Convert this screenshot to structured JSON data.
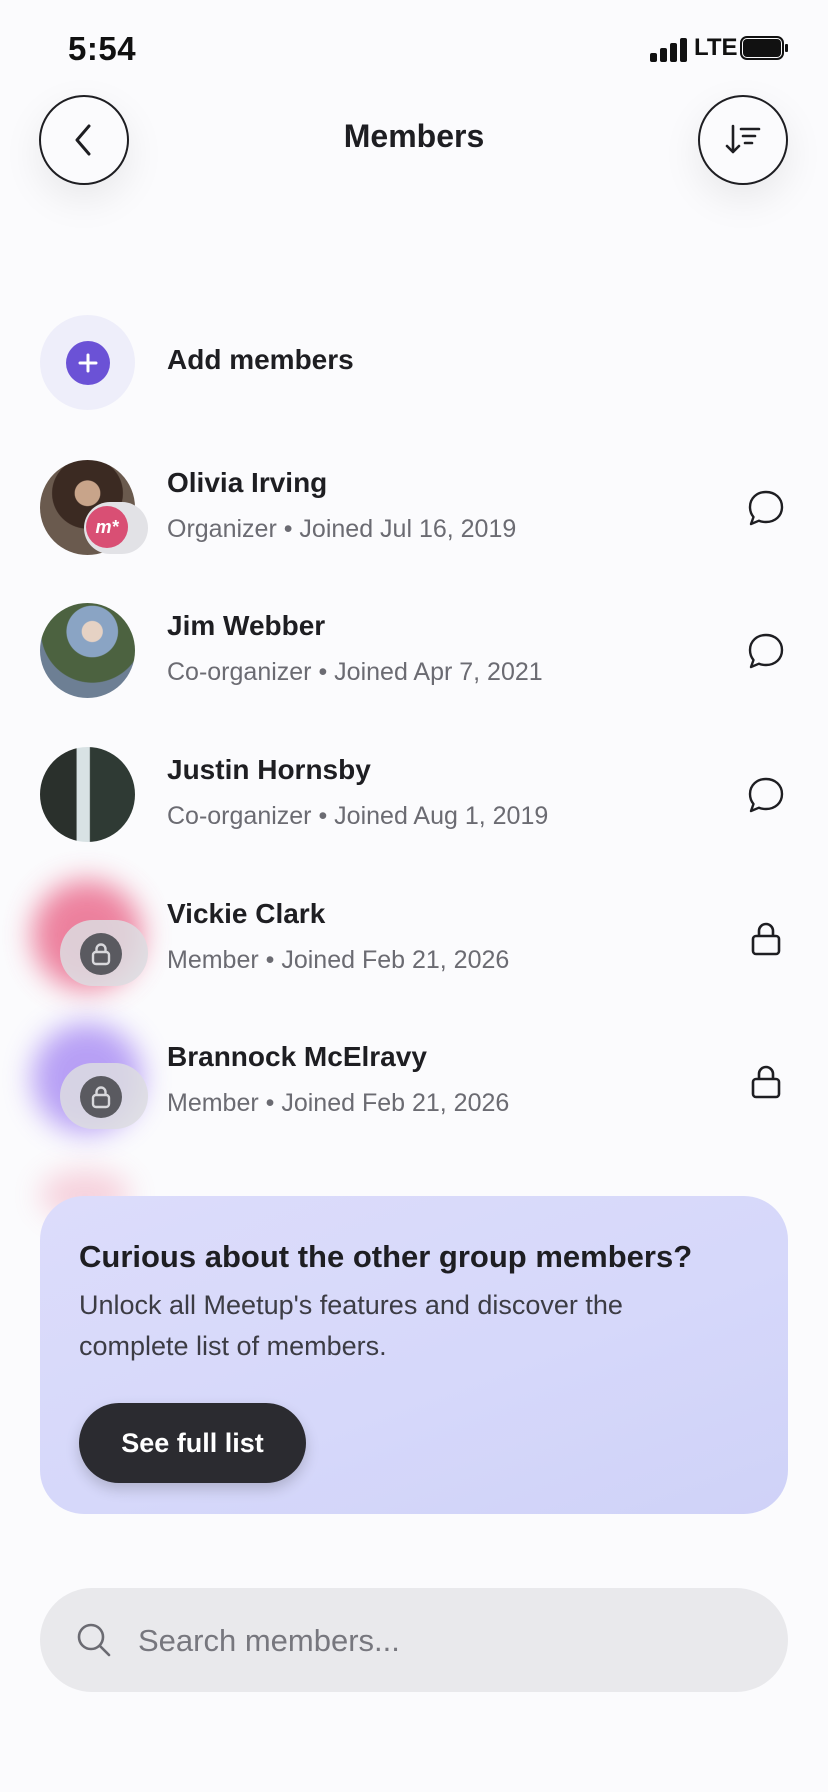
{
  "status_bar": {
    "time": "5:54",
    "network": "LTE"
  },
  "header": {
    "title": "Members",
    "back_icon": "chevron-left-icon",
    "sort_icon": "sort-descending-icon"
  },
  "add_members": {
    "label": "Add members",
    "icon": "plus-icon",
    "accent": "#6b52d6"
  },
  "members": [
    {
      "name": "Olivia Irving",
      "role": "Organizer",
      "joined": "Joined Jul 16, 2019",
      "action_icon": "chat-bubble-icon",
      "badge": "m*",
      "badge_color": "#d94f74"
    },
    {
      "name": "Jim Webber",
      "role": "Co-organizer",
      "joined": "Joined Apr 7, 2021",
      "action_icon": "chat-bubble-icon"
    },
    {
      "name": "Justin Hornsby",
      "role": "Co-organizer",
      "joined": "Joined Aug 1, 2019",
      "action_icon": "chat-bubble-icon"
    },
    {
      "name": "Vickie Clark",
      "role": "Member",
      "joined": "Joined Feb 21, 2026",
      "action_icon": "lock-icon",
      "blob_color": "#e8587e"
    },
    {
      "name": "Brannock McElravy",
      "role": "Member",
      "joined": "Joined Feb 21, 2026",
      "action_icon": "lock-icon",
      "blob_color": "#8a63f0"
    }
  ],
  "promo": {
    "title": "Curious about the other group members?",
    "body": "Unlock all Meetup's features and discover the complete list of members.",
    "button_label": "See full list"
  },
  "search": {
    "placeholder": "Search members...",
    "value": ""
  }
}
